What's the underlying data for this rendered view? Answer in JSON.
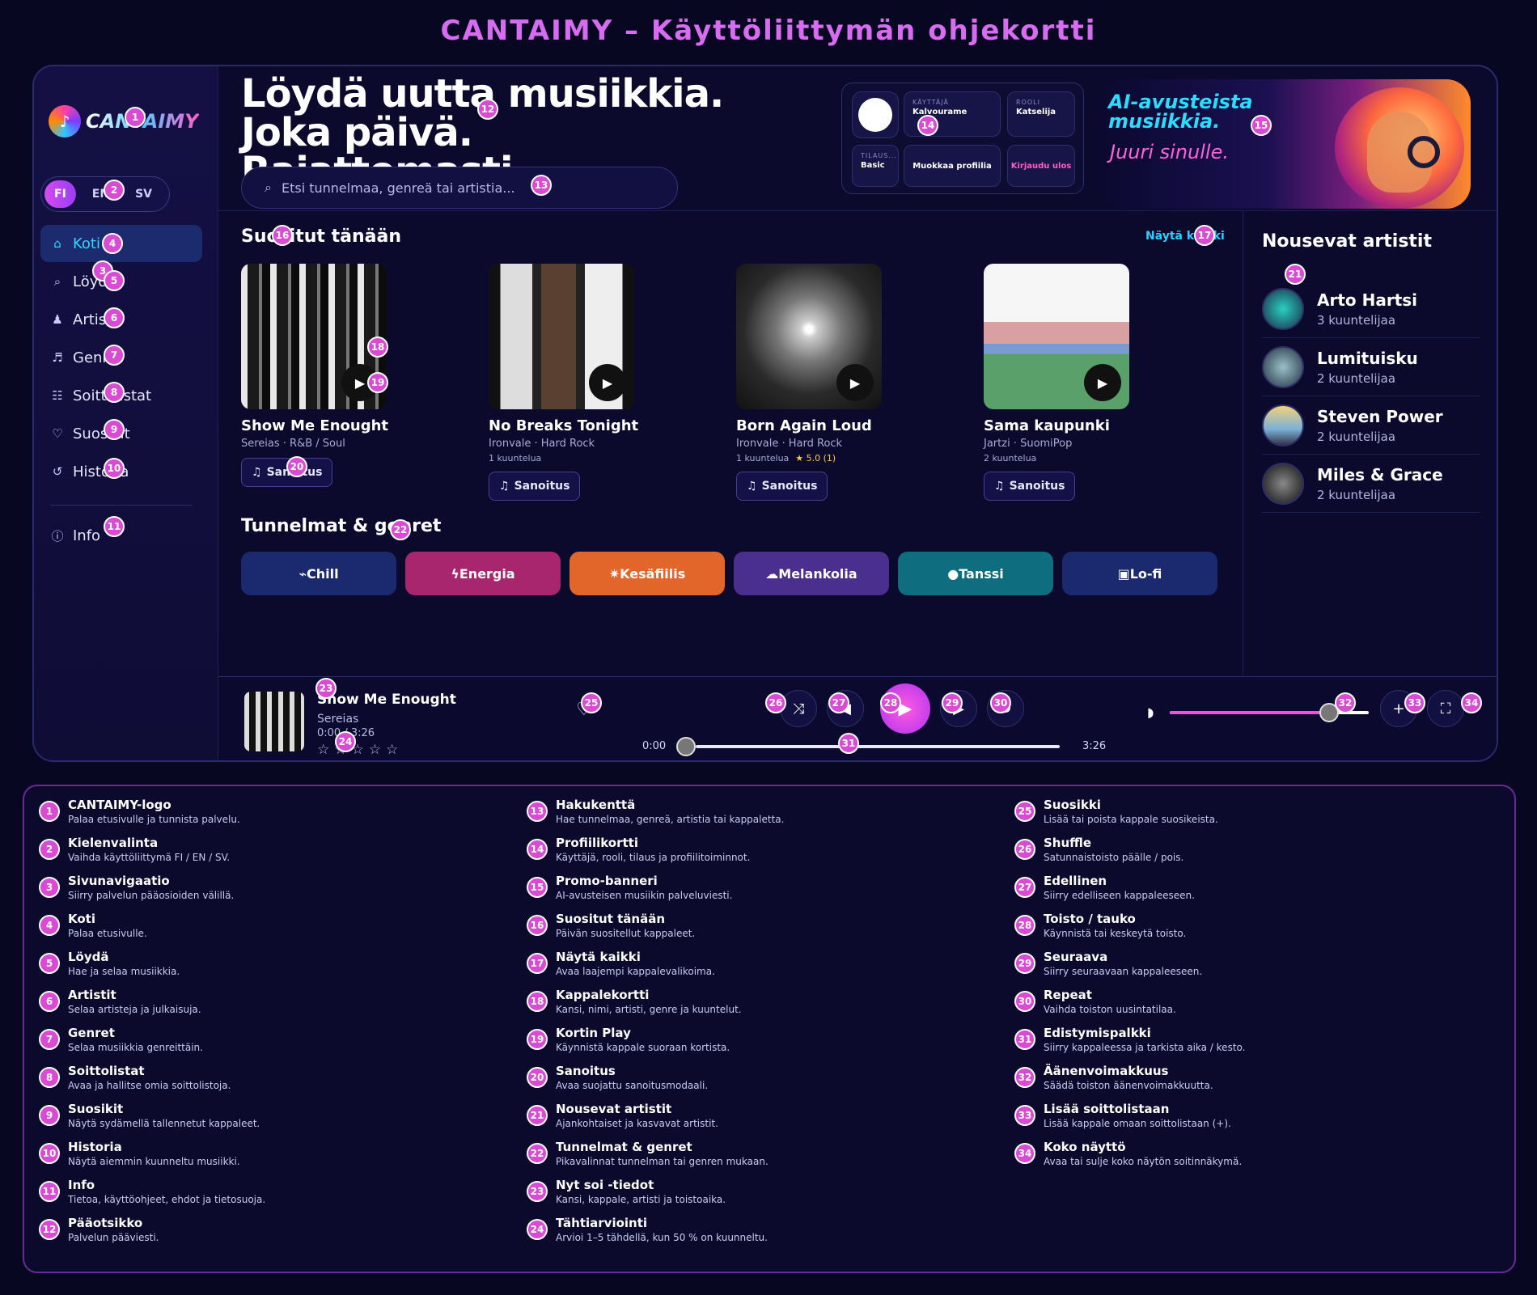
{
  "page_title": "CANTAIMY – Käyttöliittymän ohjekortti",
  "logo": {
    "mark": "♪",
    "text": "CANTAIMY"
  },
  "languages": [
    "FI",
    "EN",
    "SV"
  ],
  "nav": [
    {
      "label": "Koti",
      "icon": "home-icon",
      "glyph": "⌂"
    },
    {
      "label": "Löydä",
      "icon": "search-icon",
      "glyph": "⌕"
    },
    {
      "label": "Artistit",
      "icon": "person-icon",
      "glyph": "♟"
    },
    {
      "label": "Genret",
      "icon": "music-note-icon",
      "glyph": "♬"
    },
    {
      "label": "Soittolistat",
      "icon": "list-icon",
      "glyph": "☷"
    },
    {
      "label": "Suosikit",
      "icon": "heart-icon",
      "glyph": "♡"
    },
    {
      "label": "Historia",
      "icon": "history-icon",
      "glyph": "↺"
    }
  ],
  "nav_info": {
    "label": "Info",
    "icon": "info-icon",
    "glyph": "ⓘ"
  },
  "hero": {
    "line1": "Löydä uutta musiikkia.",
    "line2": "Joka päivä. Rajattomasti."
  },
  "search": {
    "placeholder": "Etsi tunnelmaa, genreä tai artistia..."
  },
  "profile": {
    "user_label": "KÄYTTÄJÄ",
    "user_value": "Kalvourame",
    "role_label": "ROOLI",
    "role_value": "Katselija",
    "plan_label": "TILAUS...",
    "plan_value": "Basic",
    "edit_label": "Muokkaa profiilia",
    "logout_label": "Kirjaudu ulos"
  },
  "promo": {
    "line1": "AI-avusteista",
    "line2": "musiikkia.",
    "line3": "Juuri sinulle."
  },
  "recommended": {
    "title": "Suositut tänään",
    "see_all": "Näytä kaikki",
    "lyrics_label": "Sanoitus",
    "cards": [
      {
        "title": "Show Me Enought",
        "meta": "Sereias · R&B / Soul",
        "listens": "",
        "rating": ""
      },
      {
        "title": "No Breaks Tonight",
        "meta": "Ironvale · Hard Rock",
        "listens": "1 kuuntelua",
        "rating": ""
      },
      {
        "title": "Born Again Loud",
        "meta": "Ironvale · Hard Rock",
        "listens": "1 kuuntelua",
        "rating": "★ 5.0 (1)"
      },
      {
        "title": "Sama kaupunki",
        "meta": "Jartzi · SuomiPop",
        "listens": "2 kuuntelua",
        "rating": ""
      }
    ]
  },
  "moods": {
    "title": "Tunnelmat & genret",
    "items": [
      {
        "label": "⌁Chill",
        "color": "#1b2a6e"
      },
      {
        "label": "ϟEnergia",
        "color": "#a8266e"
      },
      {
        "label": "✷Kesäfiilis",
        "color": "#e2662a"
      },
      {
        "label": "☁Melankolia",
        "color": "#4a2f8e"
      },
      {
        "label": "●Tanssi",
        "color": "#0e6e80"
      },
      {
        "label": "▣Lo-fi",
        "color": "#1b2a6e"
      }
    ]
  },
  "rising": {
    "title": "Nousevat artistit",
    "artists": [
      {
        "name": "Arto Hartsi",
        "count": "3 kuuntelijaa"
      },
      {
        "name": "Lumituisku",
        "count": "2 kuuntelijaa"
      },
      {
        "name": "Steven Power",
        "count": "2 kuuntelijaa"
      },
      {
        "name": "Miles & Grace",
        "count": "2 kuuntelijaa"
      }
    ]
  },
  "player": {
    "title": "Show Me Enought",
    "artist": "Sereias",
    "time": "0:00 / 3:26",
    "stars": "☆☆☆☆☆",
    "elapsed": "0:00",
    "duration": "3:26",
    "progress": 0,
    "volume": 0.8,
    "controls": {
      "shuffle": "⤨",
      "prev": "◀",
      "play": "▶",
      "next": "▶",
      "repeat": "↻",
      "add": "+",
      "fullscreen": "⛶",
      "heart": "♡",
      "volume": "◗"
    }
  },
  "legend": [
    {
      "n": "1",
      "title": "CANTAIMY-logo",
      "desc": "Palaa etusivulle ja tunnista palvelu."
    },
    {
      "n": "2",
      "title": "Kielenvalinta",
      "desc": "Vaihda käyttöliittymä FI / EN / SV."
    },
    {
      "n": "3",
      "title": "Sivunavigaatio",
      "desc": "Siirry palvelun pääosioiden välillä."
    },
    {
      "n": "4",
      "title": "Koti",
      "desc": "Palaa etusivulle."
    },
    {
      "n": "5",
      "title": "Löydä",
      "desc": "Hae ja selaa musiikkia."
    },
    {
      "n": "6",
      "title": "Artistit",
      "desc": "Selaa artisteja ja julkaisuja."
    },
    {
      "n": "7",
      "title": "Genret",
      "desc": "Selaa musiikkia genreittäin."
    },
    {
      "n": "8",
      "title": "Soittolistat",
      "desc": "Avaa ja hallitse omia soittolistoja."
    },
    {
      "n": "9",
      "title": "Suosikit",
      "desc": "Näytä sydämellä tallennetut kappaleet."
    },
    {
      "n": "10",
      "title": "Historia",
      "desc": "Näytä aiemmin kuunneltu musiikki."
    },
    {
      "n": "11",
      "title": "Info",
      "desc": "Tietoa, käyttöohjeet, ehdot ja tietosuoja."
    },
    {
      "n": "12",
      "title": "Pääotsikko",
      "desc": "Palvelun pääviesti."
    },
    {
      "n": "13",
      "title": "Hakukenttä",
      "desc": "Hae tunnelmaa, genreä, artistia tai kappaletta."
    },
    {
      "n": "14",
      "title": "Profiilikortti",
      "desc": "Käyttäjä, rooli, tilaus ja profiilitoiminnot."
    },
    {
      "n": "15",
      "title": "Promo-banneri",
      "desc": "AI-avusteisen musiikin palveluviesti."
    },
    {
      "n": "16",
      "title": "Suositut tänään",
      "desc": "Päivän suositellut kappaleet."
    },
    {
      "n": "17",
      "title": "Näytä kaikki",
      "desc": "Avaa laajempi kappalevalikoima."
    },
    {
      "n": "18",
      "title": "Kappalekortti",
      "desc": "Kansi, nimi, artisti, genre ja kuuntelut."
    },
    {
      "n": "19",
      "title": "Kortin Play",
      "desc": "Käynnistä kappale suoraan kortista."
    },
    {
      "n": "20",
      "title": "Sanoitus",
      "desc": "Avaa suojattu sanoitusmodaali."
    },
    {
      "n": "21",
      "title": "Nousevat artistit",
      "desc": "Ajankohtaiset ja kasvavat artistit."
    },
    {
      "n": "22",
      "title": "Tunnelmat & genret",
      "desc": "Pikavalinnat tunnelman tai genren mukaan."
    },
    {
      "n": "23",
      "title": "Nyt soi -tiedot",
      "desc": "Kansi, kappale, artisti ja toistoaika."
    },
    {
      "n": "24",
      "title": "Tähtiarviointi",
      "desc": "Arvioi 1–5 tähdellä, kun 50 % on kuunneltu."
    },
    {
      "n": "25",
      "title": "Suosikki",
      "desc": "Lisää tai poista kappale suosikeista."
    },
    {
      "n": "26",
      "title": "Shuffle",
      "desc": "Satunnaistoisto päälle / pois."
    },
    {
      "n": "27",
      "title": "Edellinen",
      "desc": "Siirry edelliseen kappaleeseen."
    },
    {
      "n": "28",
      "title": "Toisto / tauko",
      "desc": "Käynnistä tai keskeytä toisto."
    },
    {
      "n": "29",
      "title": "Seuraava",
      "desc": "Siirry seuraavaan kappaleeseen."
    },
    {
      "n": "30",
      "title": "Repeat",
      "desc": "Vaihda toiston uusintatilaa."
    },
    {
      "n": "31",
      "title": "Edistymispalkki",
      "desc": "Siirry kappaleessa ja tarkista aika / kesto."
    },
    {
      "n": "32",
      "title": "Äänenvoimakkuus",
      "desc": "Säädä toiston äänenvoimakkuutta."
    },
    {
      "n": "33",
      "title": "Lisää soittolistaan",
      "desc": "Lisää kappale omaan soittolistaan (+)."
    },
    {
      "n": "34",
      "title": "Koko näyttö",
      "desc": "Avaa tai sulje koko näytön soitinnäkymä."
    }
  ],
  "markers": [
    "1",
    "2",
    "3",
    "4",
    "5",
    "6",
    "7",
    "8",
    "9",
    "10",
    "11",
    "12",
    "13",
    "14",
    "15",
    "16",
    "17",
    "18",
    "19",
    "20",
    "21",
    "22",
    "23",
    "24",
    "25",
    "26",
    "27",
    "28",
    "29",
    "30",
    "31",
    "32",
    "33",
    "34"
  ]
}
